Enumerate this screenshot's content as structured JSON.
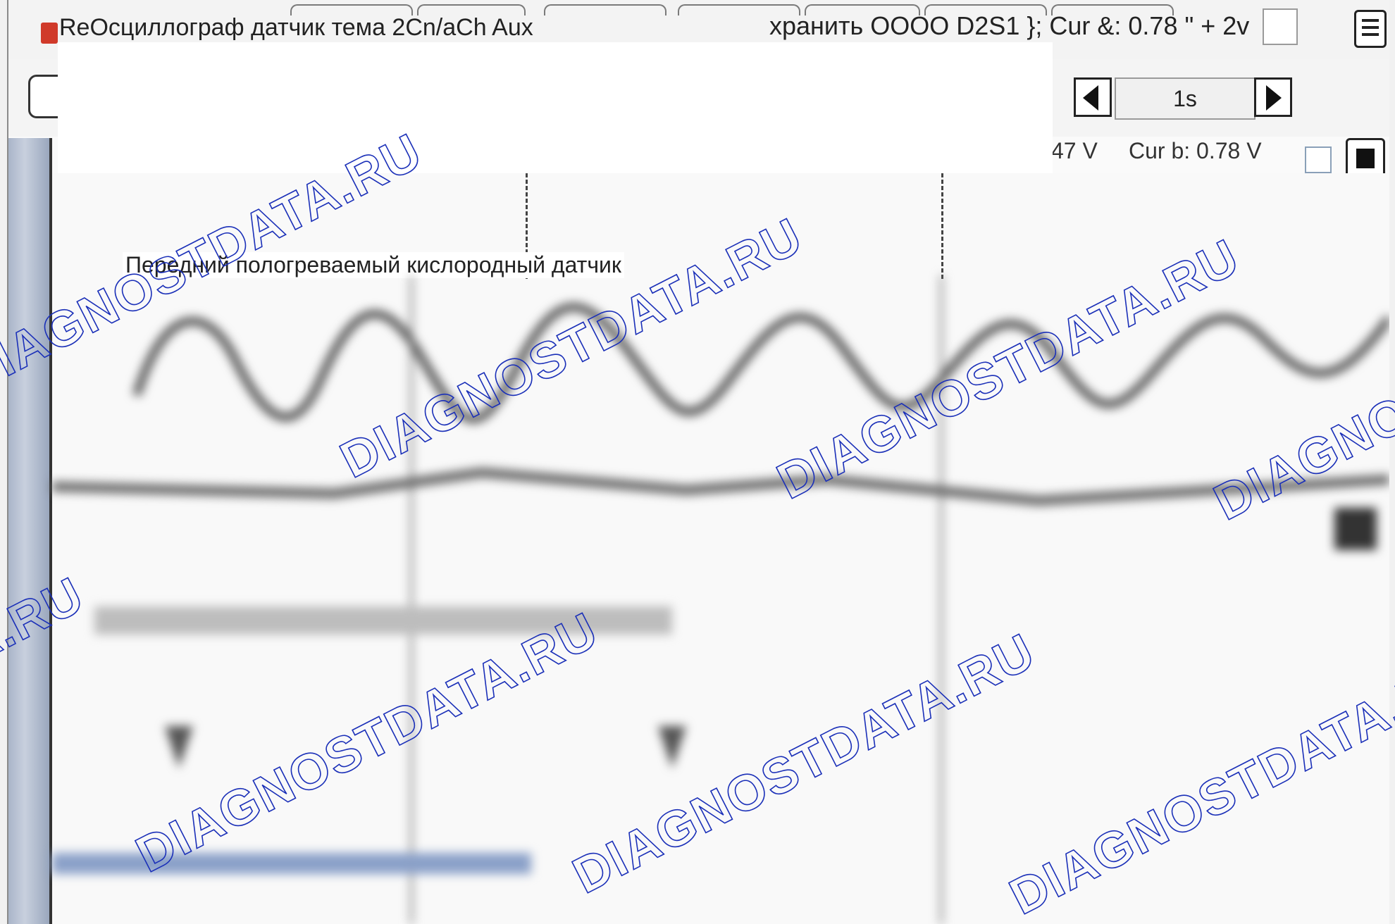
{
  "window": {
    "title": "Осциллограф датчик тема 2Cn/aCh Aux",
    "title_prefix": "Re",
    "cursor_readout": "хранить OOOO D2S1 }; Cur &: 0.78 \" + 2v"
  },
  "timebase": {
    "value": "1s"
  },
  "cursors": {
    "cursor_a_tail": "47 V",
    "cursor_b": "Cur b: 0.78 V"
  },
  "channel": {
    "label": "Передний пологреваемый кислородный датчик"
  },
  "watermark": {
    "text_a": "DIAGNOSTDATA.RU",
    "text_b": "DIAGNOSTDATA.RU"
  },
  "colors": {
    "watermark": "#1a2fb8",
    "app_icon": "#d03a2a",
    "sidebar": "#aab5c9"
  },
  "icons": [
    "app-icon",
    "menu-icon",
    "arrow-left-icon",
    "arrow-right-icon",
    "stop-icon",
    "checkbox-icon"
  ]
}
